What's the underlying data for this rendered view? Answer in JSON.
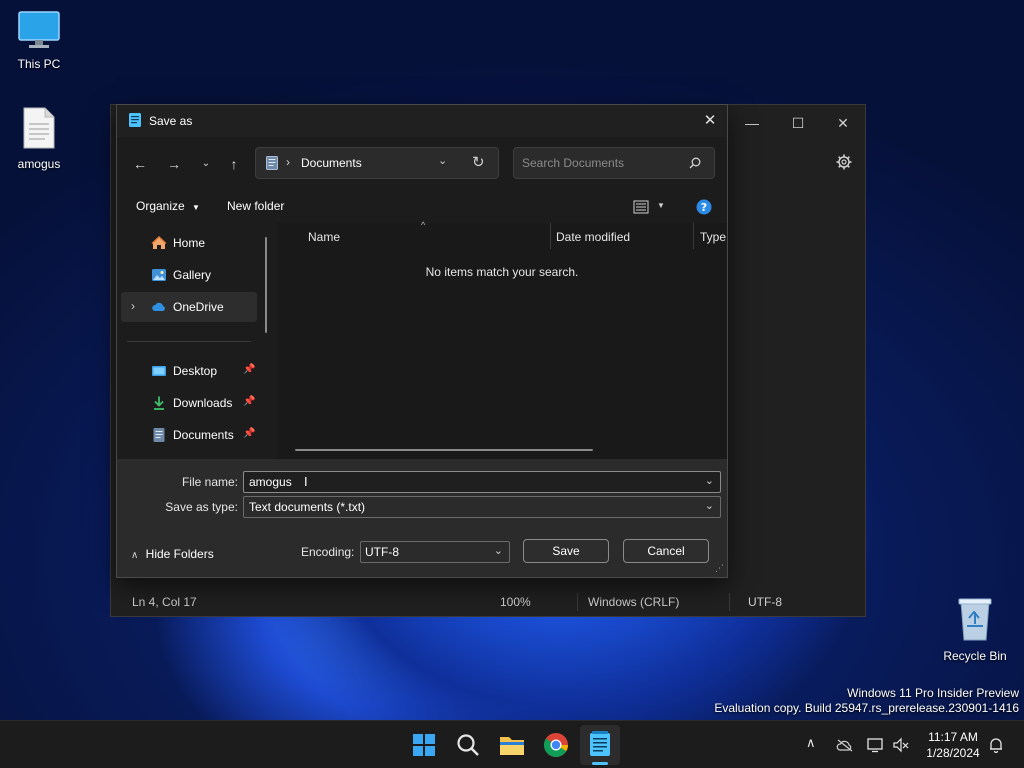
{
  "desktop": {
    "icons": [
      {
        "label": "This PC",
        "icon": "monitor-icon"
      },
      {
        "label": "amogus",
        "icon": "text-file-icon"
      },
      {
        "label": "Recycle Bin",
        "icon": "recycle-bin-icon"
      }
    ],
    "watermark": {
      "line1": "Windows 11 Pro Insider Preview",
      "line2": "Evaluation copy. Build 25947.rs_prerelease.230901-1416"
    }
  },
  "notepad": {
    "status": {
      "position": "Ln 4, Col 17",
      "zoom": "100%",
      "line_ending": "Windows (CRLF)",
      "encoding": "UTF-8"
    }
  },
  "dialog": {
    "title": "Save as",
    "address": {
      "current": "Documents"
    },
    "search": {
      "placeholder": "Search Documents"
    },
    "toolbar": {
      "organize": "Organize",
      "new_folder": "New folder"
    },
    "sidebar": {
      "items": [
        {
          "label": "Home",
          "icon": "home-icon"
        },
        {
          "label": "Gallery",
          "icon": "gallery-icon"
        },
        {
          "label": "OneDrive",
          "icon": "cloud-icon"
        },
        {
          "label": "Desktop",
          "icon": "desktop-icon"
        },
        {
          "label": "Downloads",
          "icon": "download-icon"
        },
        {
          "label": "Documents",
          "icon": "documents-icon"
        }
      ]
    },
    "columns": [
      "Name",
      "Date modified",
      "Type"
    ],
    "empty_message": "No items match your search.",
    "file_name_label": "File name:",
    "file_name_value": "amogus",
    "save_type_label": "Save as type:",
    "save_type_value": "Text documents (*.txt)",
    "hide_folders": "Hide Folders",
    "encoding_label": "Encoding:",
    "encoding_value": "UTF-8",
    "save_label": "Save",
    "cancel_label": "Cancel"
  },
  "taskbar": {
    "apps": [
      "start-icon",
      "search-icon",
      "file-explorer-icon",
      "chrome-icon",
      "notepad-icon"
    ],
    "time": "11:17 AM",
    "date": "1/28/2024"
  },
  "colors": {
    "accent": "#4cc2ff",
    "dialog_bg": "#1c1c1c",
    "taskbar_bg": "#1c1c1c"
  }
}
